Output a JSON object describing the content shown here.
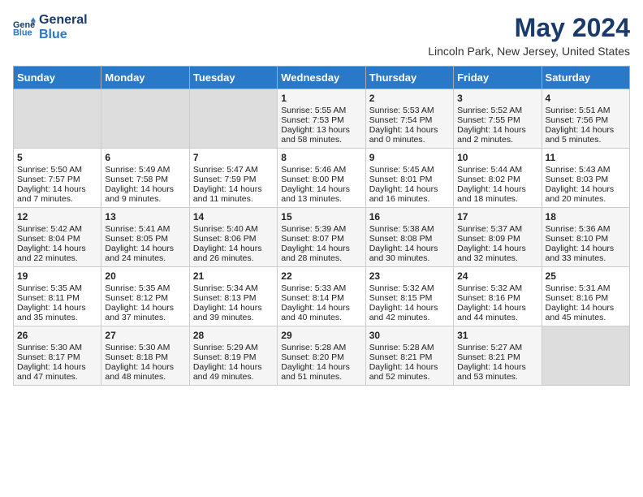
{
  "header": {
    "logo_line1": "General",
    "logo_line2": "Blue",
    "title": "May 2024",
    "subtitle": "Lincoln Park, New Jersey, United States"
  },
  "days_of_week": [
    "Sunday",
    "Monday",
    "Tuesday",
    "Wednesday",
    "Thursday",
    "Friday",
    "Saturday"
  ],
  "weeks": [
    [
      {
        "day": "",
        "empty": true
      },
      {
        "day": "",
        "empty": true
      },
      {
        "day": "",
        "empty": true
      },
      {
        "day": "1",
        "sunrise": "5:55 AM",
        "sunset": "7:53 PM",
        "daylight": "13 hours and 58 minutes."
      },
      {
        "day": "2",
        "sunrise": "5:53 AM",
        "sunset": "7:54 PM",
        "daylight": "14 hours and 0 minutes."
      },
      {
        "day": "3",
        "sunrise": "5:52 AM",
        "sunset": "7:55 PM",
        "daylight": "14 hours and 2 minutes."
      },
      {
        "day": "4",
        "sunrise": "5:51 AM",
        "sunset": "7:56 PM",
        "daylight": "14 hours and 5 minutes."
      }
    ],
    [
      {
        "day": "5",
        "sunrise": "5:50 AM",
        "sunset": "7:57 PM",
        "daylight": "14 hours and 7 minutes."
      },
      {
        "day": "6",
        "sunrise": "5:49 AM",
        "sunset": "7:58 PM",
        "daylight": "14 hours and 9 minutes."
      },
      {
        "day": "7",
        "sunrise": "5:47 AM",
        "sunset": "7:59 PM",
        "daylight": "14 hours and 11 minutes."
      },
      {
        "day": "8",
        "sunrise": "5:46 AM",
        "sunset": "8:00 PM",
        "daylight": "14 hours and 13 minutes."
      },
      {
        "day": "9",
        "sunrise": "5:45 AM",
        "sunset": "8:01 PM",
        "daylight": "14 hours and 16 minutes."
      },
      {
        "day": "10",
        "sunrise": "5:44 AM",
        "sunset": "8:02 PM",
        "daylight": "14 hours and 18 minutes."
      },
      {
        "day": "11",
        "sunrise": "5:43 AM",
        "sunset": "8:03 PM",
        "daylight": "14 hours and 20 minutes."
      }
    ],
    [
      {
        "day": "12",
        "sunrise": "5:42 AM",
        "sunset": "8:04 PM",
        "daylight": "14 hours and 22 minutes."
      },
      {
        "day": "13",
        "sunrise": "5:41 AM",
        "sunset": "8:05 PM",
        "daylight": "14 hours and 24 minutes."
      },
      {
        "day": "14",
        "sunrise": "5:40 AM",
        "sunset": "8:06 PM",
        "daylight": "14 hours and 26 minutes."
      },
      {
        "day": "15",
        "sunrise": "5:39 AM",
        "sunset": "8:07 PM",
        "daylight": "14 hours and 28 minutes."
      },
      {
        "day": "16",
        "sunrise": "5:38 AM",
        "sunset": "8:08 PM",
        "daylight": "14 hours and 30 minutes."
      },
      {
        "day": "17",
        "sunrise": "5:37 AM",
        "sunset": "8:09 PM",
        "daylight": "14 hours and 32 minutes."
      },
      {
        "day": "18",
        "sunrise": "5:36 AM",
        "sunset": "8:10 PM",
        "daylight": "14 hours and 33 minutes."
      }
    ],
    [
      {
        "day": "19",
        "sunrise": "5:35 AM",
        "sunset": "8:11 PM",
        "daylight": "14 hours and 35 minutes."
      },
      {
        "day": "20",
        "sunrise": "5:35 AM",
        "sunset": "8:12 PM",
        "daylight": "14 hours and 37 minutes."
      },
      {
        "day": "21",
        "sunrise": "5:34 AM",
        "sunset": "8:13 PM",
        "daylight": "14 hours and 39 minutes."
      },
      {
        "day": "22",
        "sunrise": "5:33 AM",
        "sunset": "8:14 PM",
        "daylight": "14 hours and 40 minutes."
      },
      {
        "day": "23",
        "sunrise": "5:32 AM",
        "sunset": "8:15 PM",
        "daylight": "14 hours and 42 minutes."
      },
      {
        "day": "24",
        "sunrise": "5:32 AM",
        "sunset": "8:16 PM",
        "daylight": "14 hours and 44 minutes."
      },
      {
        "day": "25",
        "sunrise": "5:31 AM",
        "sunset": "8:16 PM",
        "daylight": "14 hours and 45 minutes."
      }
    ],
    [
      {
        "day": "26",
        "sunrise": "5:30 AM",
        "sunset": "8:17 PM",
        "daylight": "14 hours and 47 minutes."
      },
      {
        "day": "27",
        "sunrise": "5:30 AM",
        "sunset": "8:18 PM",
        "daylight": "14 hours and 48 minutes."
      },
      {
        "day": "28",
        "sunrise": "5:29 AM",
        "sunset": "8:19 PM",
        "daylight": "14 hours and 49 minutes."
      },
      {
        "day": "29",
        "sunrise": "5:28 AM",
        "sunset": "8:20 PM",
        "daylight": "14 hours and 51 minutes."
      },
      {
        "day": "30",
        "sunrise": "5:28 AM",
        "sunset": "8:21 PM",
        "daylight": "14 hours and 52 minutes."
      },
      {
        "day": "31",
        "sunrise": "5:27 AM",
        "sunset": "8:21 PM",
        "daylight": "14 hours and 53 minutes."
      },
      {
        "day": "",
        "empty": true
      }
    ]
  ],
  "labels": {
    "sunrise": "Sunrise:",
    "sunset": "Sunset:",
    "daylight": "Daylight:"
  }
}
